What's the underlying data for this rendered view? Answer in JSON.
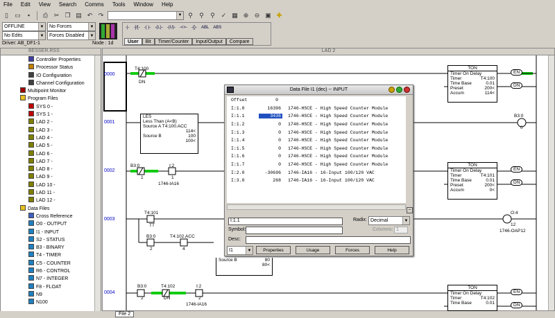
{
  "menu": [
    "File",
    "Edit",
    "View",
    "Search",
    "Comms",
    "Tools",
    "Window",
    "Help"
  ],
  "status_combos": {
    "mode": "OFFLINE",
    "forces": "No Forces",
    "edits": "No Edits",
    "forces_state": "Forces Disabled"
  },
  "driver": "Driver: AB_DF1-1",
  "node": "Node : 1d",
  "instr_tabs": [
    "User",
    "Bit",
    "Timer/Counter",
    "Input/Output",
    "Compare"
  ],
  "instr_icons": [
    "-|-",
    "-]/[-",
    "-( )-",
    "-(L)-",
    "-(U)-",
    "-<>-",
    "-{}-",
    "ABL",
    "ABS"
  ],
  "tree": {
    "title": "BESSER.RSS",
    "items": [
      {
        "label": "Controller Properties",
        "indent": 40,
        "icon": "gear-icon",
        "color": "#4040a0"
      },
      {
        "label": "Processor Status",
        "indent": 40,
        "icon": "cpu-icon",
        "color": "#c08000"
      },
      {
        "label": "IO Configuration",
        "indent": 40,
        "icon": "io-icon",
        "color": "#404040"
      },
      {
        "label": "Channel Configuration",
        "indent": 40,
        "icon": "channel-icon",
        "color": "#404040"
      },
      {
        "label": "Multipoint Monitor",
        "indent": 28,
        "icon": "monitor-icon",
        "color": "#a00000"
      },
      {
        "label": "Program Files",
        "indent": 28,
        "icon": "folder-icon",
        "color": "#e8c020"
      },
      {
        "label": "SYS 0 -",
        "indent": 40,
        "icon": "program-icon",
        "color": "#c00000"
      },
      {
        "label": "SYS 1 -",
        "indent": 40,
        "icon": "program-icon",
        "color": "#c00000"
      },
      {
        "label": "LAD 2 -",
        "indent": 40,
        "icon": "ladder-icon",
        "color": "#808000"
      },
      {
        "label": "LAD 3 -",
        "indent": 40,
        "icon": "ladder-icon",
        "color": "#808000"
      },
      {
        "label": "LAD 4 -",
        "indent": 40,
        "icon": "ladder-icon",
        "color": "#808000"
      },
      {
        "label": "LAD 5 -",
        "indent": 40,
        "icon": "ladder-icon",
        "color": "#808000"
      },
      {
        "label": "LAD 6 -",
        "indent": 40,
        "icon": "ladder-icon",
        "color": "#808000"
      },
      {
        "label": "LAD 7 -",
        "indent": 40,
        "icon": "ladder-icon",
        "color": "#808000"
      },
      {
        "label": "LAD 8 -",
        "indent": 40,
        "icon": "ladder-icon",
        "color": "#808000"
      },
      {
        "label": "LAD 9 -",
        "indent": 40,
        "icon": "ladder-icon",
        "color": "#808000"
      },
      {
        "label": "LAD 10 -",
        "indent": 40,
        "icon": "ladder-icon",
        "color": "#808000"
      },
      {
        "label": "LAD 11 -",
        "indent": 40,
        "icon": "ladder-icon",
        "color": "#808000"
      },
      {
        "label": "LAD 12 -",
        "indent": 40,
        "icon": "ladder-icon",
        "color": "#808000"
      },
      {
        "label": "Data Files",
        "indent": 28,
        "icon": "folder-icon",
        "color": "#e8c020"
      },
      {
        "label": "Cross Reference",
        "indent": 40,
        "icon": "crossref-icon",
        "color": "#4060c0"
      },
      {
        "label": "O0 - OUTPUT",
        "indent": 40,
        "icon": "datafile-icon",
        "color": "#2080c0"
      },
      {
        "label": "I1 - INPUT",
        "indent": 40,
        "icon": "datafile-icon",
        "color": "#2080c0"
      },
      {
        "label": "S2 - STATUS",
        "indent": 40,
        "icon": "datafile-icon",
        "color": "#2080c0"
      },
      {
        "label": "B3 - BINARY",
        "indent": 40,
        "icon": "datafile-icon",
        "color": "#2080c0"
      },
      {
        "label": "T4 - TIMER",
        "indent": 40,
        "icon": "datafile-icon",
        "color": "#2080c0"
      },
      {
        "label": "C5 - COUNTER",
        "indent": 40,
        "icon": "datafile-icon",
        "color": "#2080c0"
      },
      {
        "label": "R6 - CONTROL",
        "indent": 40,
        "icon": "datafile-icon",
        "color": "#2080c0"
      },
      {
        "label": "N7 - INTEGER",
        "indent": 40,
        "icon": "datafile-icon",
        "color": "#2080c0"
      },
      {
        "label": "F8 - FLOAT",
        "indent": 40,
        "icon": "datafile-icon",
        "color": "#2080c0"
      },
      {
        "label": "N9",
        "indent": 40,
        "icon": "datafile-icon",
        "color": "#2080c0"
      },
      {
        "label": "N100",
        "indent": 40,
        "icon": "datafile-icon",
        "color": "#2080c0"
      }
    ]
  },
  "ladder": {
    "title": "LAD 2",
    "rungs": [
      "0000",
      "0001",
      "0002",
      "0003",
      "0004"
    ],
    "r0": {
      "contact": "T4:100",
      "contact_sub": "DN",
      "ton_title": "TON",
      "ton_name": "Timer On Delay",
      "timer_lbl": "Timer",
      "timer": "T4:100",
      "tb_lbl": "Time Base",
      "tb": "0.01",
      "pre_lbl": "Preset",
      "pre": "200<",
      "acc_lbl": "Accum",
      "acc": "114<",
      "en": "EN",
      "dn": "DN"
    },
    "r1": {
      "les": "LES",
      "les_name": "Less Than (A<B)",
      "srca_lbl": "Source A",
      "srca": "T4:100.ACC",
      "srca_val": "114<",
      "srcb_lbl": "Source B",
      "srcb": "100",
      "srcb_val": "100<",
      "coil": "B3:0",
      "coil_bit": "0"
    },
    "r2": {
      "c1": "B3:0",
      "c1b": "1",
      "c2": "I:2",
      "c2b": "1",
      "c2d": "1746-IA16",
      "timer": "T4:101",
      "pre": "200<",
      "acc": "0<"
    },
    "r3": {
      "c1": "T4:101",
      "c1b": "TT",
      "c2": "B3:0",
      "c2b": "2",
      "c3": "T4:102.ACC",
      "c3b": "4",
      "coil": "O:4",
      "coil_b": "12",
      "coil_d": "1746-OAP12",
      "srcb_lbl": "Source B",
      "srcb": "80",
      "srcb_val": "80<"
    },
    "r4": {
      "c1": "B3:0",
      "c1b": "2",
      "c2": "T4:102",
      "c2b": "DN",
      "c3": "I:2",
      "c3b": "2",
      "c3d": "1746-IA16",
      "timer": "T4:102",
      "tb": "0.01"
    }
  },
  "dialog": {
    "title": "Data File I1 (dec) -- INPUT",
    "offset_lbl": "Offset",
    "offset_val": "0",
    "rows": [
      {
        "addr": "I:1.0",
        "val": "16396",
        "desc": "1746-HSCE - High Speed Counter Module"
      },
      {
        "addr": "I:1.1",
        "val": "3436",
        "desc": "1746-HSCE - High Speed Counter Module",
        "sel": true
      },
      {
        "addr": "I:1.2",
        "val": "0",
        "desc": "1746-HSCE - High Speed Counter Module"
      },
      {
        "addr": "I:1.3",
        "val": "0",
        "desc": "1746-HSCE - High Speed Counter Module"
      },
      {
        "addr": "I:1.4",
        "val": "0",
        "desc": "1746-HSCE - High Speed Counter Module"
      },
      {
        "addr": "I:1.5",
        "val": "0",
        "desc": "1746-HSCE - High Speed Counter Module"
      },
      {
        "addr": "I:1.6",
        "val": "0",
        "desc": "1746-HSCE - High Speed Counter Module"
      },
      {
        "addr": "I:1.7",
        "val": "0",
        "desc": "1746-HSCE - High Speed Counter Module"
      },
      {
        "addr": "I:2.0",
        "val": "-30696",
        "desc": "1746-IA16 - 16-Input 100/120 VAC"
      },
      {
        "addr": "I:3.0",
        "val": "268",
        "desc": "1746-IA16 - 16-Input 100/120 VAC"
      }
    ],
    "address": "I:1.1",
    "radix_lbl": "Radix:",
    "radix": "Decimal",
    "symbol_lbl": "Symbol:",
    "columns_lbl": "Columns:",
    "columns": "1",
    "desc_lbl": "Desc:",
    "file": "I1",
    "buttons": [
      "Properties",
      "Usage",
      "Forces",
      "Help"
    ]
  },
  "file_tab": "File 2"
}
